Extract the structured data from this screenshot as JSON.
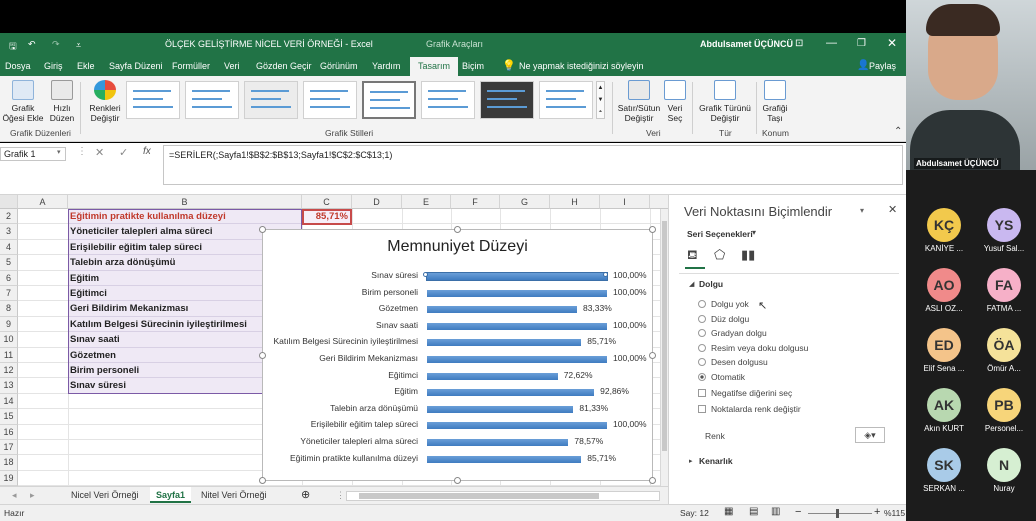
{
  "window": {
    "title": "ÖLÇEK GELİŞTİRME NİCEL VERİ ÖRNEĞİ  -  Excel",
    "context": "Grafik Araçları",
    "user": "Abdulsamet ÜÇÜNCÜ"
  },
  "ribbon_tabs": [
    "Dosya",
    "Giriş",
    "Ekle",
    "Sayfa Düzeni",
    "Formüller",
    "Veri",
    "Gözden Geçir",
    "Görünüm",
    "Yardım",
    "Tasarım",
    "Biçim"
  ],
  "tell_me": "Ne yapmak istediğinizi söyleyin",
  "share": "Paylaş",
  "ribbon": {
    "add_element": "Grafik Öğesi Ekle",
    "quick_layout": "Hızlı Düzen",
    "change_colors": "Renkleri Değiştir",
    "switch_row_col": "Satır/Sütun Değiştir",
    "select_data": "Veri Seç",
    "change_type": "Grafik Türünü Değiştir",
    "move_chart": "Grafiği Taşı",
    "groups": [
      "Grafik Düzenleri",
      "Grafik Stilleri",
      "Veri",
      "Tür",
      "Konum"
    ]
  },
  "name_box": "Grafik 1",
  "formula": "=SERİLER(;Sayfa1!$B$2:$B$13;Sayfa1!$C$2:$C$13;1)",
  "columns": [
    "A",
    "B",
    "C",
    "D",
    "E",
    "F",
    "G",
    "H",
    "I"
  ],
  "rows": [
    "2",
    "3",
    "4",
    "5",
    "6",
    "7",
    "8",
    "9",
    "10",
    "11",
    "12",
    "13",
    "14",
    "15",
    "16",
    "17",
    "18",
    "19"
  ],
  "cells_b": [
    "Eğitimin pratikte kullanılma düzeyi",
    "Yöneticiler talepleri alma süreci",
    "Erişilebilir eğitim talep süreci",
    "Talebin arza dönüşümü",
    "Eğitim",
    "Eğitimci",
    " Geri Bildirim Mekanizması",
    " Katılım Belgesi Sürecinin iyileştirilmesi",
    "Sınav saati",
    "Gözetmen",
    "Birim personeli",
    "Sınav süresi"
  ],
  "cell_c2": "85,71%",
  "chart_data": {
    "type": "bar",
    "title": "Memnuniyet Düzeyi",
    "categories": [
      "Sınav süresi",
      "Birim personeli",
      "Gözetmen",
      "Sınav saati",
      "Katılım Belgesi Sürecinin iyileştirilmesi",
      "Geri Bildirim Mekanizması",
      "Eğitimci",
      "Eğitim",
      "Talebin arza dönüşümü",
      "Erişilebilir eğitim talep süreci",
      "Yöneticiler talepleri alma süreci",
      "Eğitimin pratikte kullanılma düzeyi"
    ],
    "values": [
      100.0,
      100.0,
      83.33,
      100.0,
      85.71,
      100.0,
      72.62,
      92.86,
      81.33,
      100.0,
      78.57,
      85.71
    ],
    "labels": [
      "100,00%",
      "100,00%",
      "83,33%",
      "100,00%",
      "85,71%",
      "100,00%",
      "72,62%",
      "92,86%",
      "81,33%",
      "100,00%",
      "78,57%",
      "85,71%"
    ],
    "xlim": [
      0,
      100
    ],
    "grid": false
  },
  "sheet_tabs": [
    "Nicel Veri Örneği",
    "Sayfa1",
    "Nitel Veri Örneği"
  ],
  "status": {
    "ready": "Hazır",
    "count": "Say: 12",
    "zoom": "%115"
  },
  "panel": {
    "title": "Veri Noktasını Biçimlendir",
    "series_options": "Seri Seçenekleri",
    "fill": "Dolgu",
    "fill_options": [
      "Dolgu yok",
      "Düz dolgu",
      "Gradyan dolgu",
      "Resim veya doku dolgusu",
      "Desen dolgusu",
      "Otomatik"
    ],
    "invert": "Negatifse diğerini seç",
    "vary": "Noktalarda renk değiştir",
    "color": "Renk",
    "border": "Kenarlık"
  },
  "participants": [
    {
      "initials": "KÇ",
      "name": "KANİYE ...",
      "color": "#f2c94c"
    },
    {
      "initials": "YS",
      "name": "Yusuf Sal...",
      "color": "#c9b8f0"
    },
    {
      "initials": "AO",
      "name": "ASLI OZ...",
      "color": "#f08a8a"
    },
    {
      "initials": "FA",
      "name": "FATMA ...",
      "color": "#f6b0c8"
    },
    {
      "initials": "ED",
      "name": "Elif Sena ...",
      "color": "#f4c48a"
    },
    {
      "initials": "ÖA",
      "name": "Ömür A...",
      "color": "#f5e29a"
    },
    {
      "initials": "AK",
      "name": "Akın KURT",
      "color": "#b8d8b0"
    },
    {
      "initials": "PB",
      "name": "Personel...",
      "color": "#f7d57a"
    },
    {
      "initials": "SK",
      "name": "SERKAN ...",
      "color": "#a9cbe8"
    },
    {
      "initials": "N",
      "name": "Nuray",
      "color": "#d6efd2"
    }
  ],
  "presenter": "Abdulsamet ÜÇÜNCÜ"
}
